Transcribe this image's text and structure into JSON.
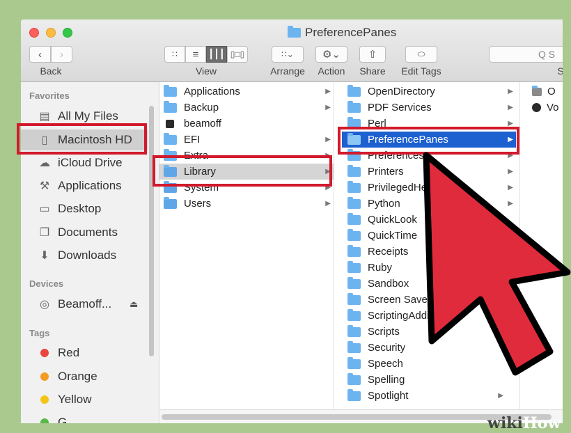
{
  "window": {
    "title": "PreferencePanes"
  },
  "toolbar": {
    "back_label": "Back",
    "view_label": "View",
    "arrange_label": "Arrange",
    "action_label": "Action",
    "share_label": "Share",
    "edit_tags_label": "Edit Tags",
    "search_placeholder": "Q S",
    "search_label": "S"
  },
  "sidebar": {
    "favorites_heading": "Favorites",
    "favorites": [
      {
        "label": "All My Files",
        "icon": "all-files-icon"
      },
      {
        "label": "Macintosh HD",
        "icon": "hard-drive-icon"
      },
      {
        "label": "iCloud Drive",
        "icon": "cloud-icon"
      },
      {
        "label": "Applications",
        "icon": "applications-icon"
      },
      {
        "label": "Desktop",
        "icon": "desktop-icon"
      },
      {
        "label": "Documents",
        "icon": "documents-icon"
      },
      {
        "label": "Downloads",
        "icon": "downloads-icon"
      }
    ],
    "devices_heading": "Devices",
    "devices": [
      {
        "label": "Beamoff...",
        "icon": "disk-icon"
      }
    ],
    "tags_heading": "Tags",
    "tags": [
      {
        "label": "Red",
        "color": "#e8463e"
      },
      {
        "label": "Orange",
        "color": "#f39c23"
      },
      {
        "label": "Yellow",
        "color": "#f2c416"
      },
      {
        "label": "G...",
        "color": "#57b947"
      }
    ]
  },
  "column1": [
    {
      "label": "Applications"
    },
    {
      "label": "Backup"
    },
    {
      "label": "beamoff"
    },
    {
      "label": "EFI"
    },
    {
      "label": "Extra"
    },
    {
      "label": "Library"
    },
    {
      "label": "System"
    },
    {
      "label": "Users"
    }
  ],
  "column2": [
    {
      "label": "OpenDirectory"
    },
    {
      "label": "PDF Services"
    },
    {
      "label": "Perl"
    },
    {
      "label": "PreferencePanes"
    },
    {
      "label": "Preferences"
    },
    {
      "label": "Printers"
    },
    {
      "label": "PrivilegedHelperTools"
    },
    {
      "label": "Python"
    },
    {
      "label": "QuickLook"
    },
    {
      "label": "QuickTime"
    },
    {
      "label": "Receipts"
    },
    {
      "label": "Ruby"
    },
    {
      "label": "Sandbox"
    },
    {
      "label": "Screen Savers"
    },
    {
      "label": "ScriptingAdditions"
    },
    {
      "label": "Scripts"
    },
    {
      "label": "Security"
    },
    {
      "label": "Speech"
    },
    {
      "label": "Spelling"
    },
    {
      "label": "Spotlight"
    }
  ],
  "column3": [
    {
      "label": "O"
    },
    {
      "label": "Vo"
    }
  ],
  "watermark": {
    "wiki": "wiki",
    "how": "How"
  },
  "colors": {
    "selection": "#1d60d0",
    "highlight": "#d21a2c",
    "arrow": "#e02b3c",
    "folder": "#6cb4f0"
  }
}
